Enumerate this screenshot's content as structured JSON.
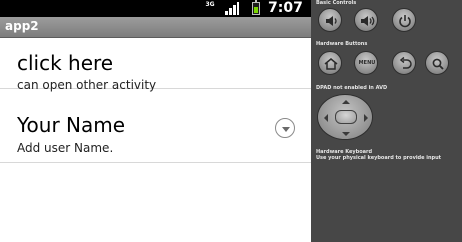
{
  "status_bar": {
    "network": "3G",
    "time": "7:07"
  },
  "app": {
    "title": "app2"
  },
  "list": [
    {
      "title": "click here",
      "subtitle": "can open other activity"
    },
    {
      "title": "Your Name",
      "subtitle": "Add user Name."
    }
  ],
  "panel": {
    "basic_controls_label": "Basic Controls",
    "hardware_buttons_label": "Hardware Buttons",
    "menu_label": "MENU",
    "dpad_label": "DPAD not enabled in AVD",
    "keyboard_label_line1": "Hardware Keyboard",
    "keyboard_label_line2": "Use your physical keyboard to provide input"
  },
  "icons": {
    "basic_controls": [
      "volume-down-icon",
      "volume-up-icon",
      "power-icon"
    ],
    "hardware_buttons": [
      "home-icon",
      "menu-icon",
      "back-icon",
      "search-icon"
    ],
    "dropdown": "chevron-down-icon"
  },
  "colors": {
    "battery_fill": "#7ad600",
    "title_bar": "#8a8a8a",
    "panel_background": "#474747",
    "divider": "#d8d8d8"
  }
}
